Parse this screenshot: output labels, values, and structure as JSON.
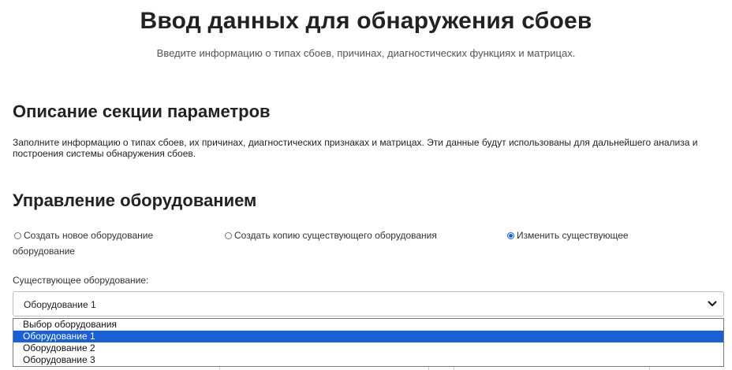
{
  "header": {
    "title": "Ввод данных для обнаружения сбоев",
    "subtitle": "Введите информацию о типах сбоев, причинах, диагностических функциях и матрицах."
  },
  "params_section": {
    "heading": "Описание секции параметров",
    "description": "Заполните информацию о типах сбоев, их причинах, диагностических признаках и матрицах. Эти данные будут использованы для дальнейшего анализа и построения системы обнаружения сбоев."
  },
  "equipment_section": {
    "heading": "Управление оборудованием",
    "radio_options": [
      {
        "label": "Создать новое оборудование",
        "checked": false
      },
      {
        "label": "Создать копию существующего оборудования",
        "checked": false
      },
      {
        "label": "Изменить существующее",
        "checked": true
      }
    ],
    "radio_wrap_text": "оборудование",
    "existing_label": "Существующее оборудование:",
    "selected_value": "Оборудование 1",
    "options": [
      "Выбор оборудования",
      "Оборудование 1",
      "Оборудование 2",
      "Оборудование 3"
    ],
    "highlighted_index": 1
  },
  "colors": {
    "accent": "#1a5fd6",
    "text": "#222222",
    "muted": "#555555"
  },
  "icons": {
    "select_chevron": "chevron-down-icon"
  }
}
